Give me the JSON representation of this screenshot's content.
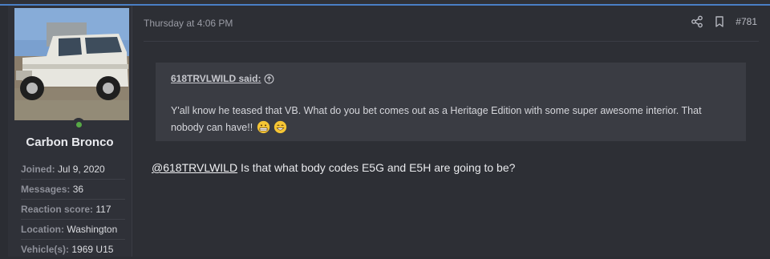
{
  "user": {
    "username": "Carbon Bronco",
    "stats": [
      {
        "label": "Joined:",
        "value": "Jul 9, 2020"
      },
      {
        "label": "Messages:",
        "value": "36"
      },
      {
        "label": "Reaction score:",
        "value": "117"
      },
      {
        "label": "Location:",
        "value": "Washington"
      },
      {
        "label": "Vehicle(s):",
        "value": "1969 U15"
      }
    ],
    "online_color": "#57a946"
  },
  "post": {
    "date": "Thursday at 4:06 PM",
    "number": "#781",
    "actions": [
      "share-icon",
      "bookmark-icon"
    ],
    "quote": {
      "author": "618TRVLWILD said:",
      "body": "Y'all know he teased that VB. What do you bet comes out as a Heritage Edition with some super awesome interior. That nobody can have!!",
      "emojis": [
        "grimacing-emoji",
        "grinning-emoji"
      ]
    },
    "reply": {
      "mention": "@618TRVLWILD",
      "text": " Is that what body codes E5G and E5H are going to be?"
    }
  },
  "colors": {
    "accent": "#4a7fc5",
    "background": "#2b2d33",
    "quote_bg": "#3a3c43"
  }
}
